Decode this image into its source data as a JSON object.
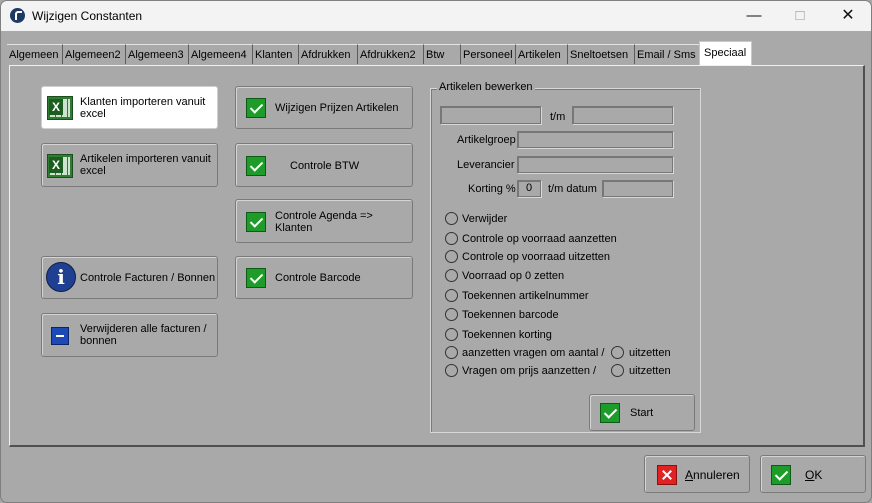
{
  "window": {
    "title": "Wijzigen Constanten"
  },
  "tabs": [
    {
      "label": "Algemeen"
    },
    {
      "label": "Algemeen2"
    },
    {
      "label": "Algemeen3"
    },
    {
      "label": "Algemeen4"
    },
    {
      "label": "Klanten"
    },
    {
      "label": "Afdrukken"
    },
    {
      "label": "Afdrukken2"
    },
    {
      "label": "Btw"
    },
    {
      "label": "Personeel"
    },
    {
      "label": "Artikelen"
    },
    {
      "label": "Sneltoetsen"
    },
    {
      "label": "Email / Sms"
    },
    {
      "label": "Speciaal",
      "active": true
    }
  ],
  "left_buttons": {
    "import_customers": "Klanten importeren vanuit excel",
    "import_articles": "Artikelen importeren vanuit excel",
    "check_invoices": "Controle Facturen / Bonnen",
    "delete_invoices": "Verwijderen alle facturen / bonnen"
  },
  "mid_buttons": {
    "change_prices": "Wijzigen Prijzen Artikelen",
    "check_vat": "Controle BTW",
    "check_agenda": "Controle Agenda => Klanten",
    "check_barcode": "Controle Barcode"
  },
  "articles_group": {
    "title": "Artikelen bewerken",
    "range_label": "t/m",
    "article_group_label": "Artikelgroep",
    "supplier_label": "Leverancier",
    "discount_label": "Korting %",
    "discount_value": "0",
    "until_date_label": "t/m datum",
    "options": [
      "Verwijder",
      "Controle op voorraad aanzetten",
      "Controle op voorraad uitzetten",
      "Voorraad op 0 zetten",
      "Toekennen artikelnummer",
      "Toekennen barcode",
      "Toekennen korting",
      "aanzetten vragen om aantal /",
      "Vragen om prijs aanzetten /"
    ],
    "off_option_label": "uitzetten",
    "start_label": "Start"
  },
  "footer": {
    "cancel_hotkey": "A",
    "cancel_rest": "nnuleren",
    "ok_hotkey": "O",
    "ok_rest": "K"
  },
  "colors": {
    "check_green": "#1e9c2a",
    "cancel_red": "#e02222",
    "info_blue": "#1f3f91",
    "background": "#a9a9a9"
  }
}
